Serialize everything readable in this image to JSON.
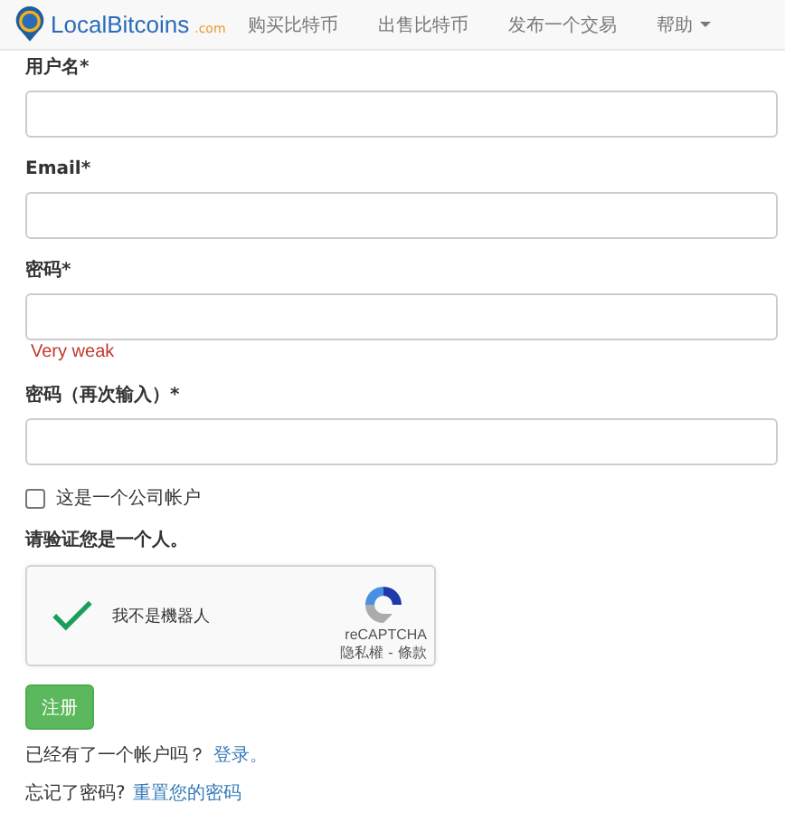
{
  "navbar": {
    "logo_text": "LocalBitcoins",
    "logo_suffix": ".com",
    "items": [
      {
        "label": "购买比特币",
        "dropdown": false
      },
      {
        "label": "出售比特币",
        "dropdown": false
      },
      {
        "label": "发布一个交易",
        "dropdown": false
      },
      {
        "label": "帮助",
        "dropdown": true
      }
    ]
  },
  "fields": [
    {
      "label": "用户名*"
    },
    {
      "label": "Email*"
    },
    {
      "label": "密码*",
      "hint": "Very weak"
    },
    {
      "label": "密码（再次输入）*"
    }
  ],
  "company_checkbox": {
    "label": "这是一个公司帐户",
    "checked": false
  },
  "captcha": {
    "prompt": "请验证您是一个人。",
    "label": "我不是機器人",
    "checked": true,
    "brand": "reCAPTCHA",
    "links": "隐私權 - 條款"
  },
  "submit": "注册",
  "footer_lines": [
    {
      "text": "已经有了一个帐户吗？",
      "link": "登录。"
    },
    {
      "text": "忘记了密码?",
      "link": "重置您的密码"
    }
  ]
}
